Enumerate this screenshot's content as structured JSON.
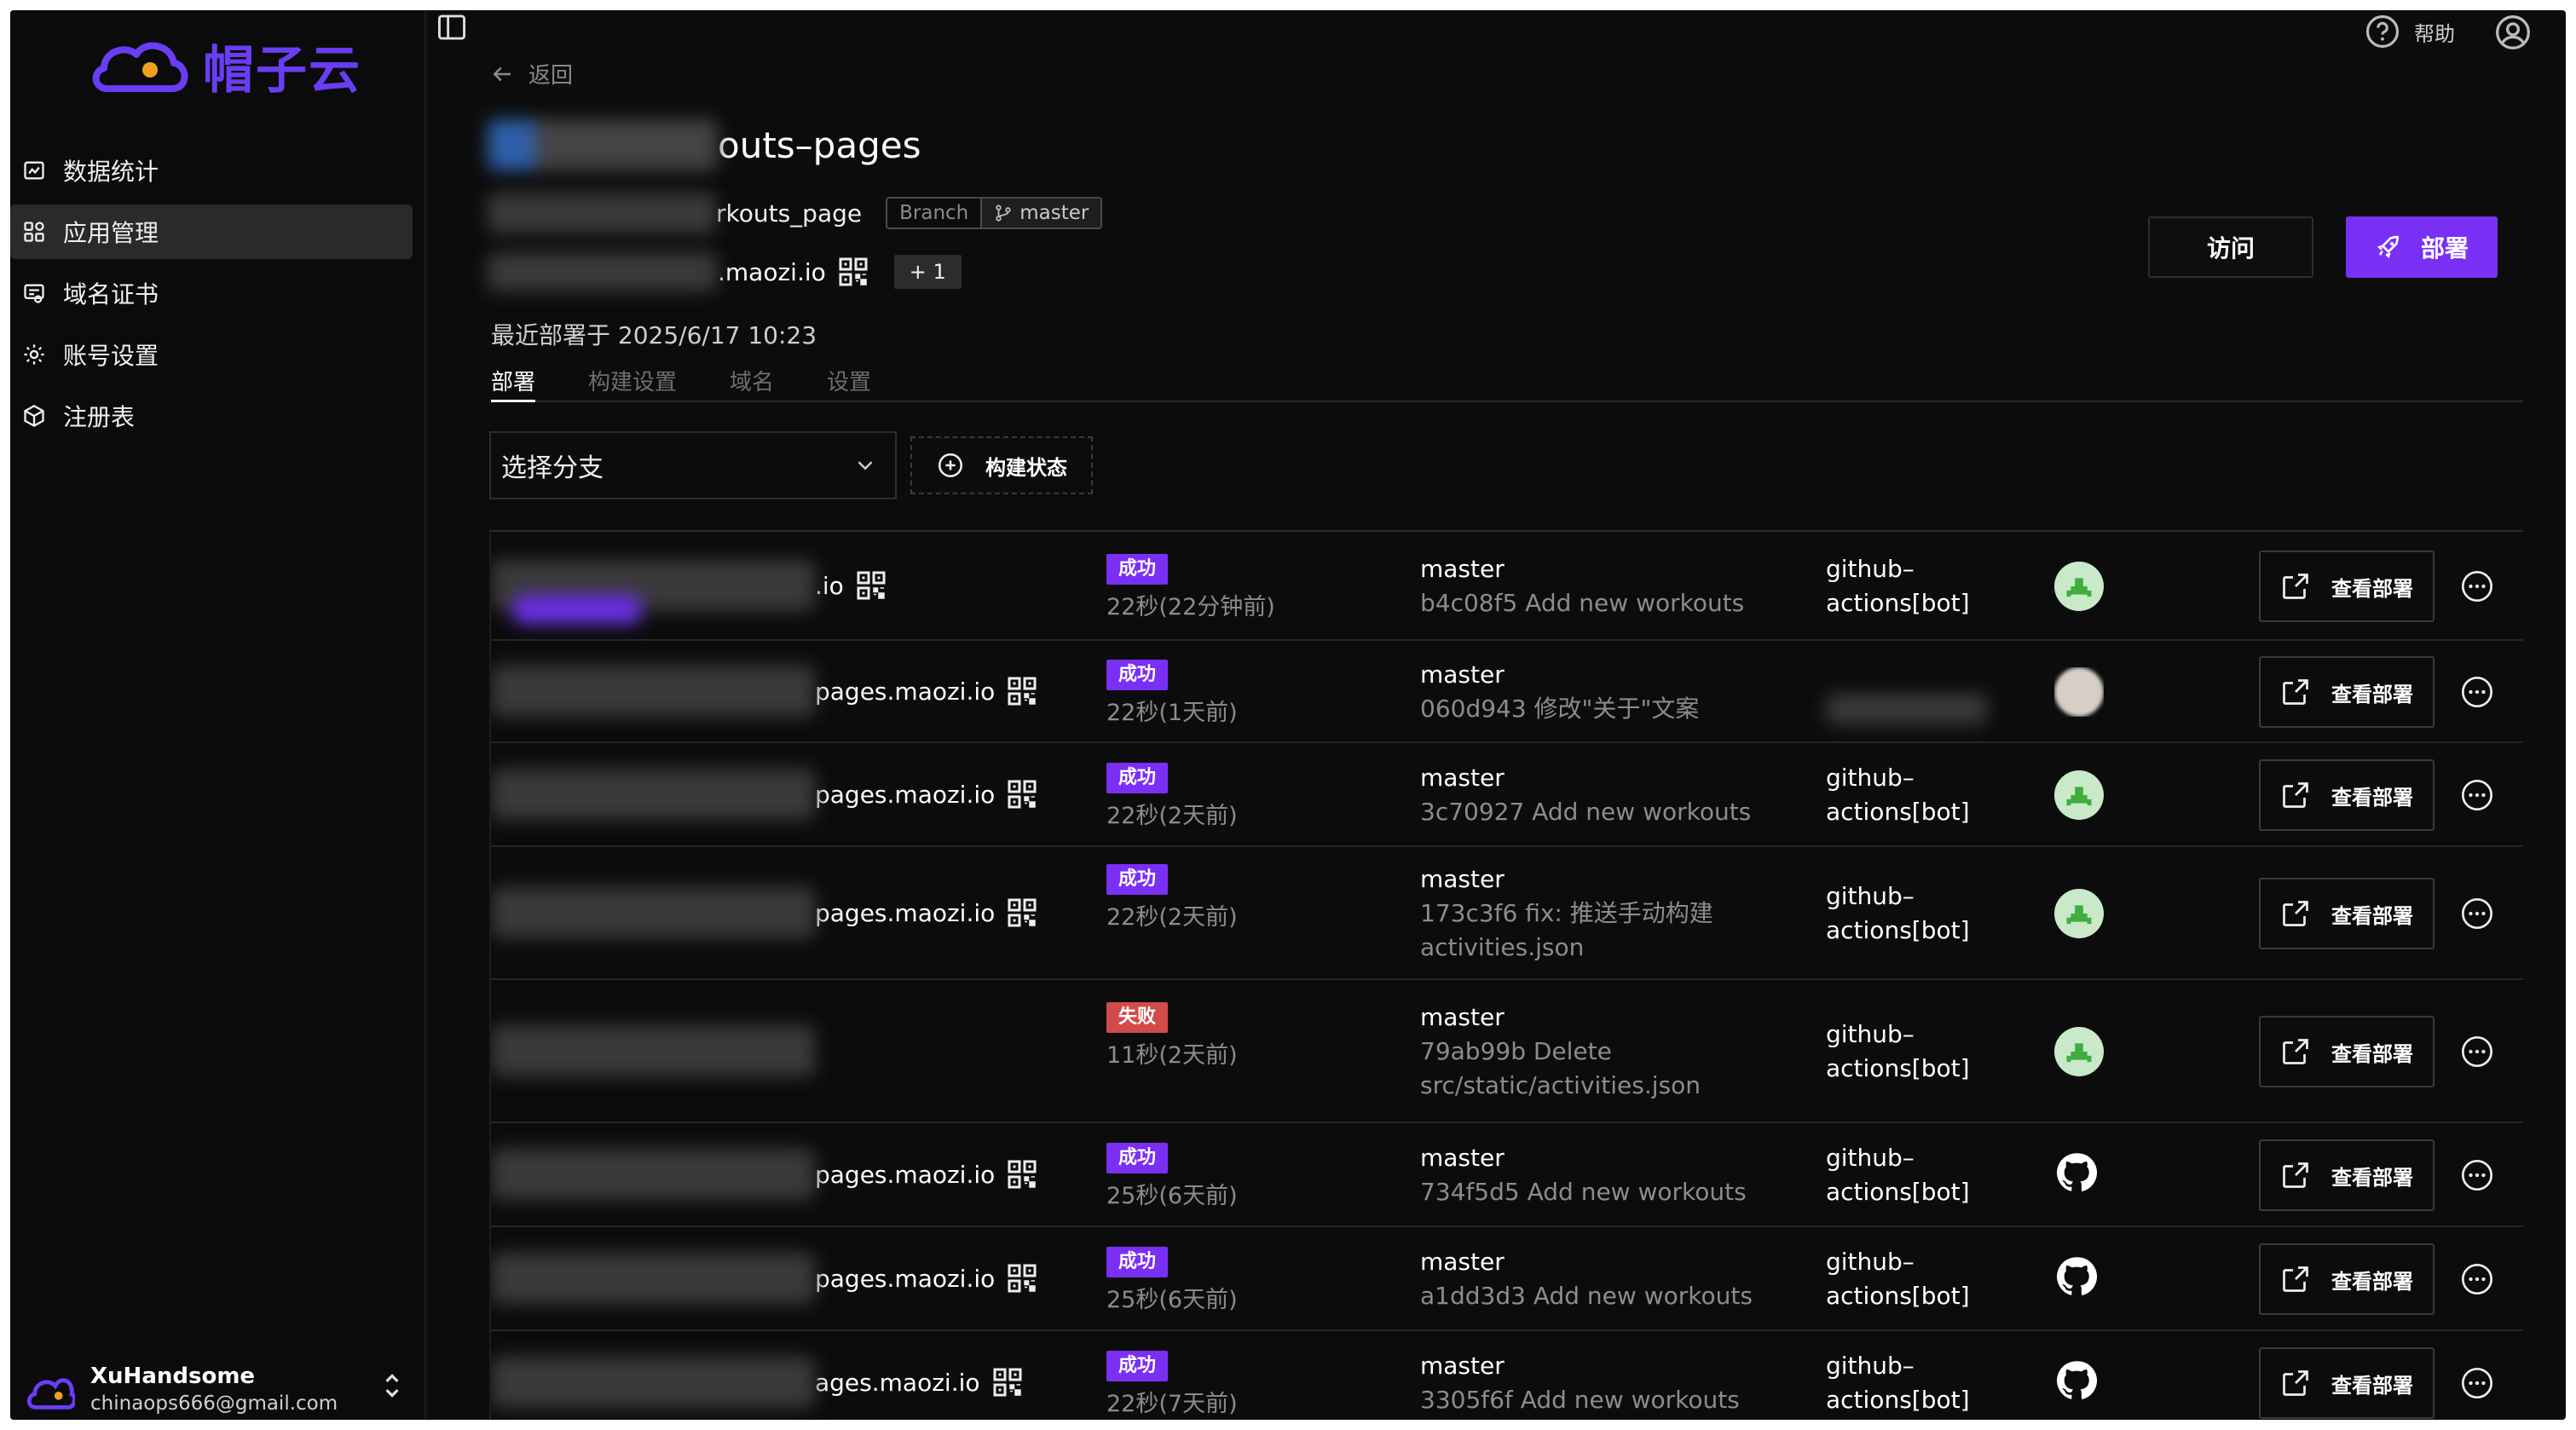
{
  "brand": {
    "logo_text": "帽子云",
    "accent": "#7a2ff5"
  },
  "sidebar": {
    "items": [
      {
        "label": "数据统计",
        "icon": "chart-icon"
      },
      {
        "label": "应用管理",
        "icon": "apps-icon",
        "active": true
      },
      {
        "label": "域名证书",
        "icon": "certificate-icon"
      },
      {
        "label": "账号设置",
        "icon": "gear-icon"
      },
      {
        "label": "注册表",
        "icon": "package-icon"
      }
    ],
    "user": {
      "name": "XuHandsome",
      "email": "chinaops666@gmail.com"
    }
  },
  "topbar": {
    "help_label": "帮助"
  },
  "header": {
    "back_label": "返回",
    "title": "outs–pages",
    "repo": "rkouts_page",
    "branch_key": "Branch",
    "branch_value": "master",
    "domain": ".maozi.io",
    "extra_domains": "+ 1",
    "last_deploy": "最近部署于 2025/6/17 10:23",
    "visit_label": "访问",
    "deploy_label": "部署"
  },
  "tabs": [
    {
      "label": "部署",
      "active": true
    },
    {
      "label": "构建设置"
    },
    {
      "label": "域名"
    },
    {
      "label": "设置"
    }
  ],
  "filters": {
    "branch_placeholder": "选择分支",
    "status_label": "构建状态"
  },
  "deployments": [
    {
      "domain": ".io",
      "status": "成功",
      "status_type": "ok",
      "duration": "22秒(22分钟前)",
      "branch": "master",
      "msg": [
        "b4c08f5 Add new workouts"
      ],
      "author": [
        "github–",
        "actions[bot]"
      ],
      "avatar": "bot-avatar-icon"
    },
    {
      "domain": "pages.maozi.io",
      "status": "成功",
      "status_type": "ok",
      "duration": "22秒(1天前)",
      "branch": "master",
      "msg": [
        "060d943 修改\"关于\"文案"
      ],
      "author": [],
      "avatar": "user-avatar-icon"
    },
    {
      "domain": "pages.maozi.io",
      "status": "成功",
      "status_type": "ok",
      "duration": "22秒(2天前)",
      "branch": "master",
      "msg": [
        "3c70927 Add new workouts"
      ],
      "author": [
        "github–",
        "actions[bot]"
      ],
      "avatar": "bot-avatar-icon"
    },
    {
      "domain": "pages.maozi.io",
      "status": "成功",
      "status_type": "ok",
      "duration": "22秒(2天前)",
      "branch": "master",
      "msg": [
        "173c3f6 fix: 推送手动构建",
        "activities.json"
      ],
      "author": [
        "github–",
        "actions[bot]"
      ],
      "avatar": "bot-avatar-icon"
    },
    {
      "domain": "",
      "status": "失败",
      "status_type": "fail",
      "duration": "11秒(2天前)",
      "branch": "master",
      "msg": [
        "79ab99b Delete",
        "src/static/activities.json"
      ],
      "author": [
        "github–",
        "actions[bot]"
      ],
      "avatar": "bot-avatar-icon"
    },
    {
      "domain": "pages.maozi.io",
      "status": "成功",
      "status_type": "ok",
      "duration": "25秒(6天前)",
      "branch": "master",
      "msg": [
        "734f5d5 Add new workouts"
      ],
      "author": [
        "github–",
        "actions[bot]"
      ],
      "avatar": "github-icon"
    },
    {
      "domain": "pages.maozi.io",
      "status": "成功",
      "status_type": "ok",
      "duration": "25秒(6天前)",
      "branch": "master",
      "msg": [
        "a1dd3d3 Add new workouts"
      ],
      "author": [
        "github–",
        "actions[bot]"
      ],
      "avatar": "github-icon"
    },
    {
      "domain": "ages.maozi.io",
      "status": "成功",
      "status_type": "ok",
      "duration": "22秒(7天前)",
      "branch": "master",
      "msg": [
        "3305f6f Add new workouts"
      ],
      "author": [
        "github–",
        "actions[bot]"
      ],
      "avatar": "github-icon"
    }
  ],
  "row_actions": {
    "view_label": "查看部署"
  }
}
